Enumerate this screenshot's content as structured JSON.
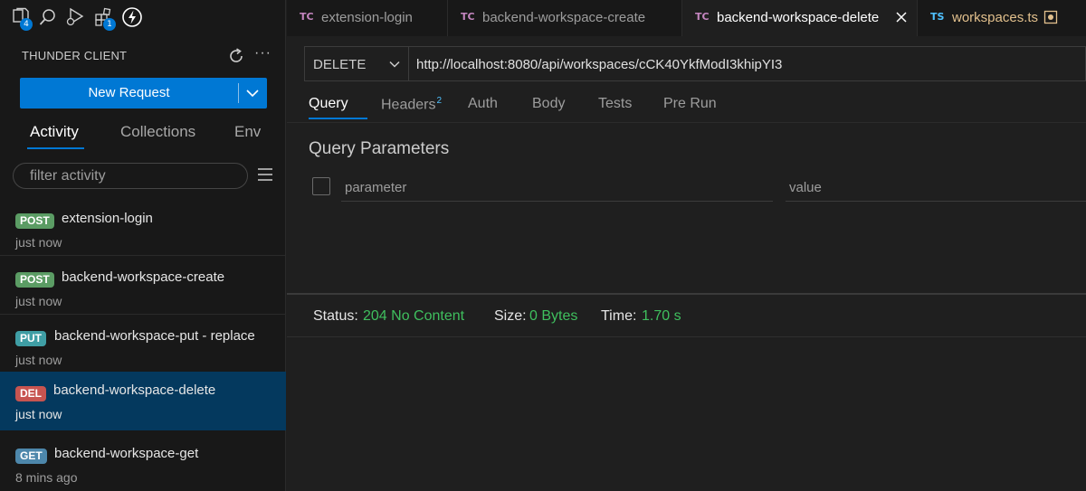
{
  "activity_bar": {
    "explorer_badge": "4",
    "extensions_badge": "1",
    "icons": [
      "files-icon",
      "search-icon",
      "run-debug-icon",
      "extensions-icon",
      "thunder-client-icon"
    ]
  },
  "sidebar": {
    "title": "THUNDER CLIENT",
    "more": "···",
    "new_request": "New Request",
    "tabs": [
      "Activity",
      "Collections",
      "Env"
    ],
    "active_tab": "Activity",
    "filter_placeholder": "filter activity",
    "activities": [
      {
        "method": "POST",
        "name": "extension-login",
        "time": "just now",
        "color": "#5b9c64"
      },
      {
        "method": "POST",
        "name": "backend-workspace-create",
        "time": "just now",
        "color": "#5b9c64"
      },
      {
        "method": "PUT",
        "name": "backend-workspace-put - replace",
        "time": "just now",
        "color": "#3f9ea5"
      },
      {
        "method": "DEL",
        "name": "backend-workspace-delete",
        "time": "just now",
        "color": "#c75450",
        "selected": true
      },
      {
        "method": "GET",
        "name": "backend-workspace-get",
        "time": "8 mins ago",
        "color": "#4d87ab"
      }
    ]
  },
  "editor_tabs": [
    {
      "kind": "TC",
      "label": "extension-login"
    },
    {
      "kind": "TC",
      "label": "backend-workspace-create"
    },
    {
      "kind": "TC",
      "label": "backend-workspace-delete",
      "active": true
    },
    {
      "kind": "TS",
      "label": "workspaces.ts",
      "modified": true
    }
  ],
  "request": {
    "method": "DELETE",
    "url": "http://localhost:8080/api/workspaces/cCK40YkfModI3khipYI3",
    "tabs": [
      "Query",
      "Headers",
      "Auth",
      "Body",
      "Tests",
      "Pre Run"
    ],
    "headers_count": "2",
    "active_tab": "Query",
    "query_title": "Query Parameters",
    "param_placeholder": "parameter",
    "value_placeholder": "value"
  },
  "response": {
    "status_label": "Status:",
    "status_value": "204 No Content",
    "size_label": "Size:",
    "size_value": "0 Bytes",
    "time_label": "Time:",
    "time_value": "1.70 s"
  },
  "colors": {
    "accent": "#0078d4",
    "success": "#3fbf5e",
    "tc_tag": "#c586c0",
    "ts_tag": "#4fc1ff",
    "ts_label": "#e2c08d"
  }
}
